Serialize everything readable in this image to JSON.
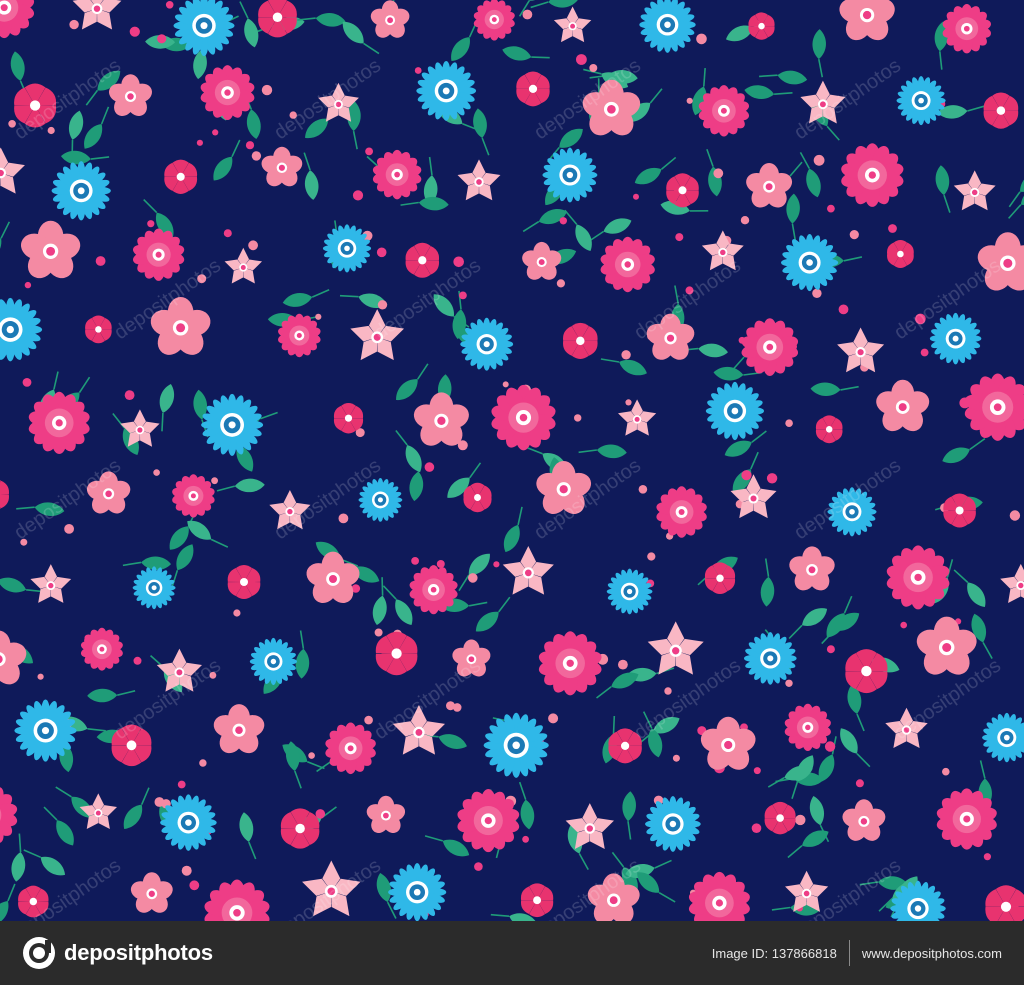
{
  "pattern": {
    "background_color": "#0f1a5a",
    "palette": {
      "hot_pink": "#ee3d86",
      "salmon_pink": "#f48aa3",
      "light_pink": "#f9b7c4",
      "cyan": "#2fb8e8",
      "leaf_green": "#1f9c78",
      "leaf_light": "#39b48c"
    }
  },
  "watermark": {
    "text": "depositphotos"
  },
  "footer": {
    "brand": "depositphotos",
    "logo_icon": "depositphotos-logo-icon",
    "image_id": "Image ID: 137866818",
    "site_url": "www.depositphotos.com",
    "background_color": "#2b2b2b"
  }
}
